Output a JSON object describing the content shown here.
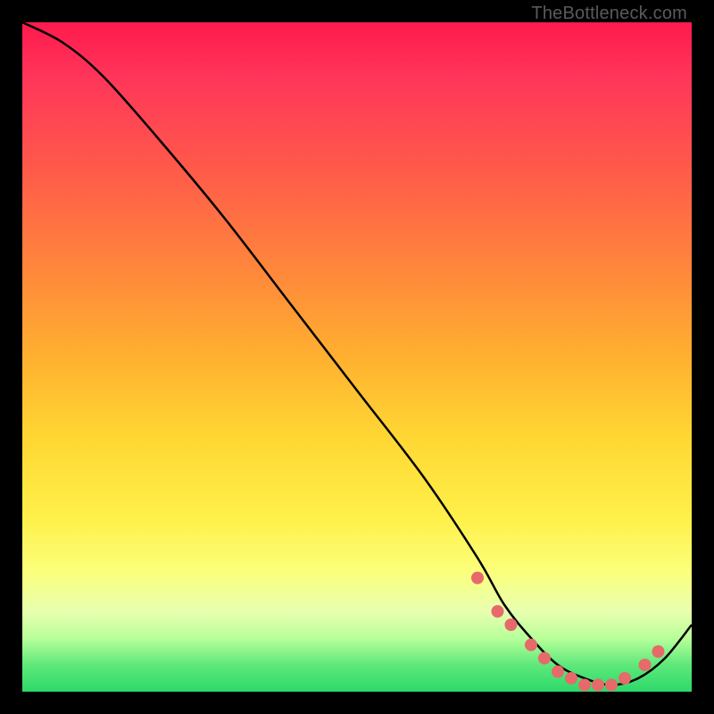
{
  "watermark": "TheBottleneck.com",
  "chart_data": {
    "type": "line",
    "title": "",
    "xlabel": "",
    "ylabel": "",
    "xlim": [
      0,
      100
    ],
    "ylim": [
      0,
      100
    ],
    "x": [
      0,
      6,
      12,
      20,
      30,
      40,
      50,
      60,
      68,
      72,
      76,
      80,
      84,
      88,
      92,
      96,
      100
    ],
    "values": [
      100,
      97,
      92,
      83,
      71,
      58,
      45,
      32,
      20,
      13,
      8,
      4,
      2,
      1,
      2,
      5,
      10
    ],
    "markers_x": [
      68,
      71,
      73,
      76,
      78,
      80,
      82,
      84,
      86,
      88,
      90,
      93,
      95
    ],
    "markers_y": [
      17,
      12,
      10,
      7,
      5,
      3,
      2,
      1,
      1,
      1,
      2,
      4,
      6
    ],
    "marker_color": "#e66a6a",
    "line_color": "#000000"
  }
}
